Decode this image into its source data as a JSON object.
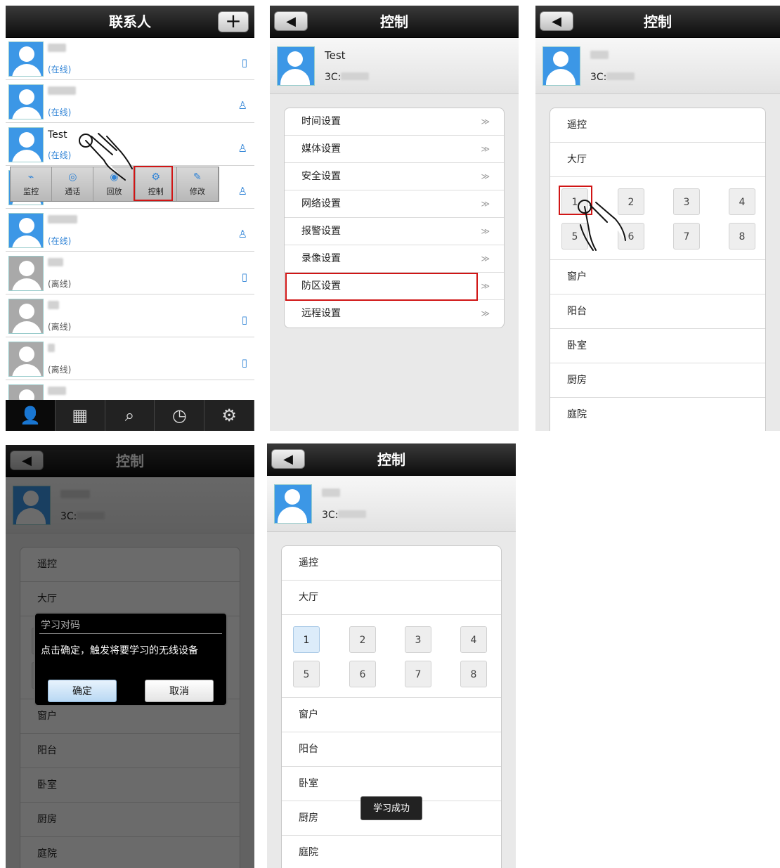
{
  "contacts": {
    "title": "联系人",
    "add_label": "+",
    "items": [
      {
        "name": "cdk",
        "status": "(在线)",
        "device": "phone"
      },
      {
        "name": "Demo",
        "status": "(在线)",
        "device": "person"
      },
      {
        "name": "Test",
        "status": "(在线)",
        "device": "person"
      },
      {
        "name": "",
        "status": "(在线)",
        "device": "person"
      },
      {
        "name": "30215",
        "status": "(在线)",
        "device": "person"
      },
      {
        "name": "me",
        "status": "(离线)",
        "device": "phone"
      },
      {
        "name": "cc",
        "status": "(离线)",
        "device": "phone"
      },
      {
        "name": "jt",
        "status": "(离线)",
        "device": "phone"
      },
      {
        "name": "test",
        "status": "",
        "device": ""
      }
    ],
    "popup": [
      "监控",
      "通话",
      "回放",
      "控制",
      "修改"
    ],
    "tabs": [
      "contacts",
      "apps",
      "search",
      "history",
      "settings"
    ]
  },
  "control": {
    "title": "控制",
    "device_name": "Test",
    "device_code_prefix": "3C:",
    "menu": [
      "时间设置",
      "媒体设置",
      "安全设置",
      "网络设置",
      "报警设置",
      "录像设置",
      "防区设置",
      "远程设置"
    ],
    "arrow": "≫"
  },
  "zones": {
    "title": "控制",
    "code_prefix": "3C:",
    "rows_top": [
      "遥控",
      "大厅"
    ],
    "keys": [
      "1",
      "2",
      "3",
      "4",
      "5",
      "6",
      "7",
      "8"
    ],
    "rows_bottom": [
      "窗户",
      "阳台",
      "卧室",
      "厨房",
      "庭院"
    ]
  },
  "dialog": {
    "title": "学习对码",
    "message": "点击确定，触发将要学习的无线设备",
    "ok": "确定",
    "cancel": "取消"
  },
  "toast": "学习成功",
  "colors": {
    "accent": "#2f83d6",
    "highlight": "#d01515",
    "avatar": "#3c97e6"
  }
}
